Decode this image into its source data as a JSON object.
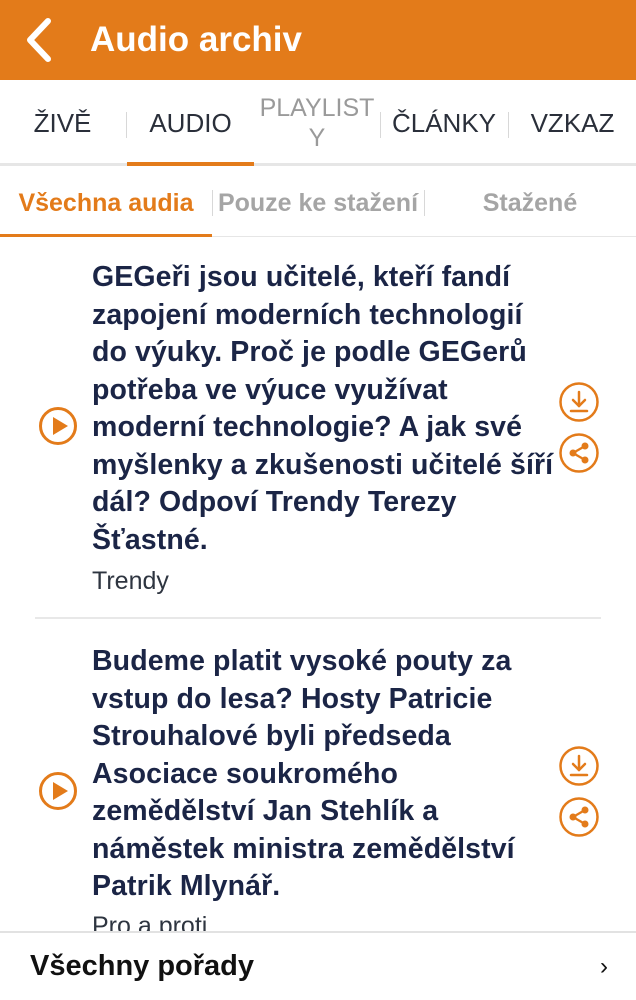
{
  "appbar": {
    "title": "Audio archiv",
    "back_icon": "chevron-left-icon",
    "color": "#e37b1a"
  },
  "tabs": [
    {
      "label": "ŽIVĚ",
      "active": false
    },
    {
      "label": "AUDIO",
      "active": true
    },
    {
      "label": "PLAYLIST Y",
      "active": false
    },
    {
      "label": "ČLÁNKY",
      "active": false
    },
    {
      "label": "VZKAZ",
      "active": false
    }
  ],
  "subtabs": [
    {
      "label": "Všechna audia",
      "active": true
    },
    {
      "label": "Pouze ke stažení",
      "active": false
    },
    {
      "label": "Stažené",
      "active": false
    }
  ],
  "items": [
    {
      "title": "GEGeři jsou učitelé, kteří fandí zapojení moderních technologií do výuky. Proč je podle GEGerů potřeba ve výuce využívat moderní technologie? A jak své myšlenky a zkušenosti učitelé šíří dál? Odpoví Trendy Terezy Šťastné.",
      "subtitle": "Trendy"
    },
    {
      "title": "Budeme platit vysoké pouty za vstup do lesa? Hosty Patricie Strouhalové byli předseda Asociace soukromého zemědělství Jan Stehlík a náměstek ministra zemědělství Patrik Mlynář.",
      "subtitle": "Pro a proti"
    }
  ],
  "icons": {
    "play": "play-icon",
    "download": "download-icon",
    "share": "share-icon"
  },
  "bottom": {
    "label": "Všechny pořady",
    "chevron": "›"
  }
}
